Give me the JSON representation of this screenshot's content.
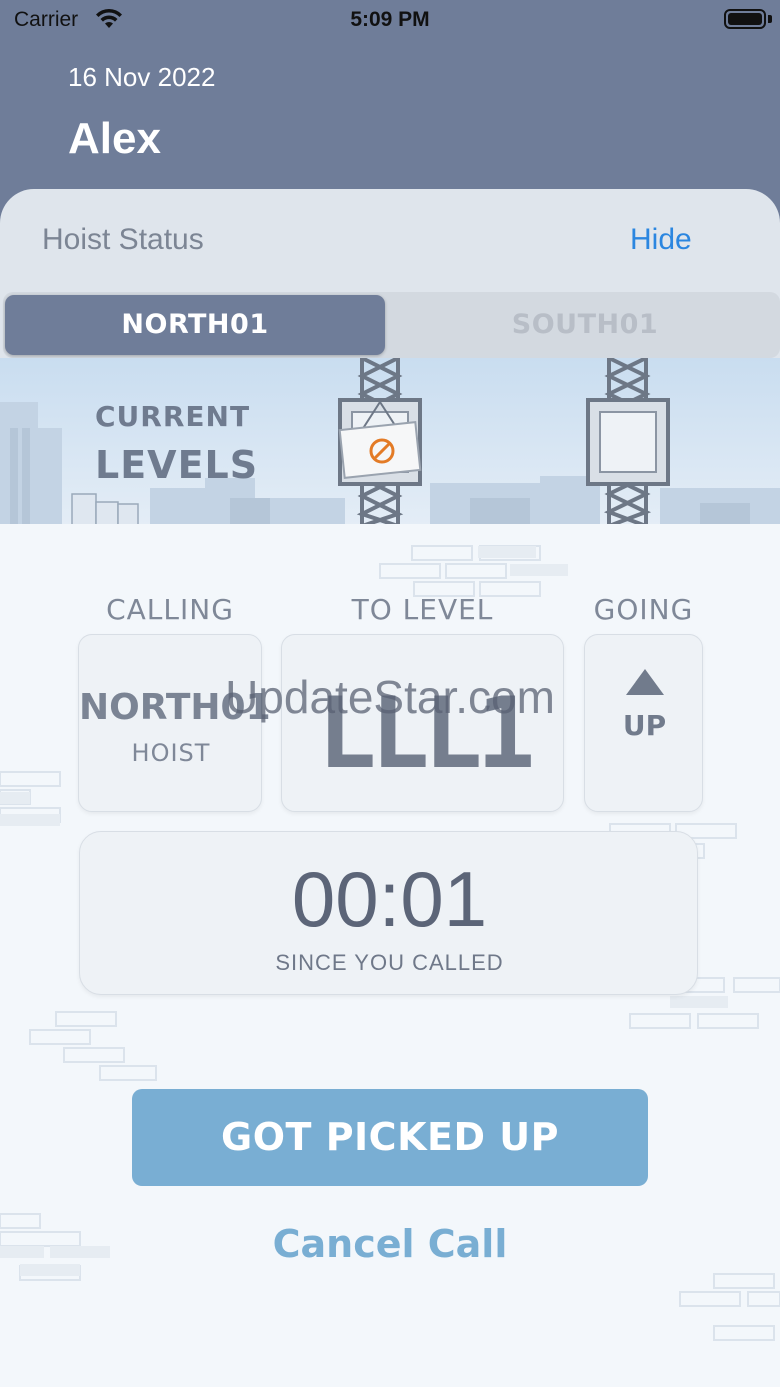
{
  "status_bar": {
    "carrier": "Carrier",
    "time": "5:09 PM",
    "wifi_icon": "wifi-icon",
    "battery_icon": "battery-icon"
  },
  "header": {
    "date": "16 Nov 2022",
    "name": "Alex"
  },
  "sheet": {
    "title": "Hoist Status",
    "hide_label": "Hide",
    "tabs": [
      {
        "label": "NORTH01",
        "selected": true
      },
      {
        "label": "SOUTH01",
        "selected": false
      }
    ],
    "scene": {
      "current_label": "CURRENT",
      "levels_label": "LEVELS",
      "sign_icon": "no-entry-icon"
    }
  },
  "call": {
    "calling_label": "CALLING",
    "to_level_label": "TO LEVEL",
    "going_label": "GOING",
    "calling_name": "NORTH01",
    "calling_sub": "HOIST",
    "level_value": "LLL1",
    "going_value": "UP",
    "going_icon": "arrow-up-icon",
    "timer_value": "00:01",
    "timer_sub": "SINCE YOU CALLED"
  },
  "watermark": "UpdateStar.com",
  "actions": {
    "primary_label": "GOT PICKED UP",
    "cancel_label": "Cancel Call"
  },
  "colors": {
    "header_bg": "#6f7d99",
    "accent_blue": "#2b86e0",
    "button_blue": "#79aed3",
    "sheet_bg": "#dfe5ec"
  }
}
